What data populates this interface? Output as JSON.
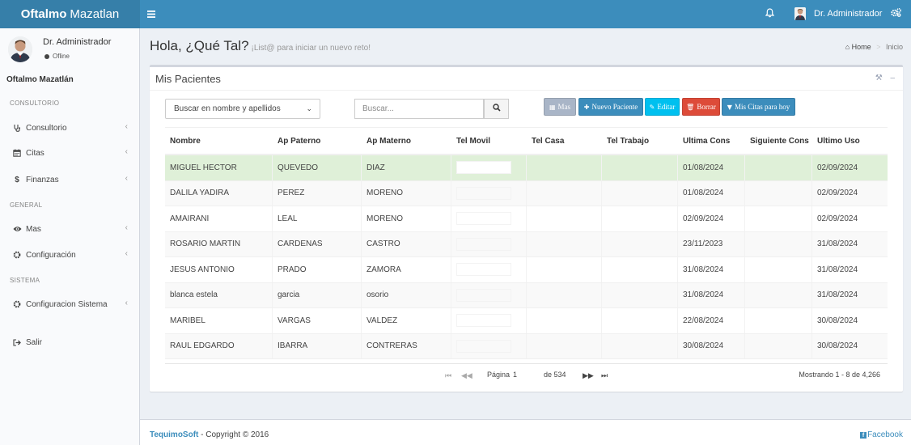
{
  "header": {
    "logo_bold": "Oftalmo",
    "logo_rest": "Mazatlan",
    "user": "Dr. Administrador"
  },
  "sidebar": {
    "user_name": "Dr. Administrador",
    "user_status": "Ofline",
    "brand": "Oftalmo Mazatlán",
    "section_consultorio": "CONSULTORIO",
    "section_general": "GENERAL",
    "section_sistema": "SISTEMA",
    "items": [
      {
        "label": "Consultorio",
        "icon": "stethoscope-icon"
      },
      {
        "label": "Citas",
        "icon": "calendar-icon"
      },
      {
        "label": "Finanzas",
        "icon": "dollar-icon"
      },
      {
        "label": "Mas",
        "icon": "eye-icon"
      },
      {
        "label": "Configuración",
        "icon": "cog-icon"
      },
      {
        "label": "Configuracion Sistema",
        "icon": "cog-icon"
      },
      {
        "label": "Salir",
        "icon": "sign-out-icon"
      }
    ]
  },
  "content": {
    "title": "Hola, ¿Qué Tal?",
    "subtitle": "¡List@ para iniciar un nuevo reto!",
    "breadcrumb_home": "Home",
    "breadcrumb_current": "Inicio"
  },
  "box": {
    "title": "Mis Pacientes",
    "filter_selected": "Buscar en nombre y apellidos",
    "search_placeholder": "Buscar...",
    "buttons": {
      "mas": "Mas",
      "nuevo": "Nuevo Paciente",
      "editar": "Editar",
      "borrar": "Borrar",
      "citas": "Mis Citas para hoy"
    }
  },
  "table": {
    "columns": [
      "Nombre",
      "Ap Paterno",
      "Ap Materno",
      "Tel Movil",
      "Tel Casa",
      "Tel Trabajo",
      "Ultima Cons",
      "Siguiente Cons",
      "Ultimo Uso"
    ],
    "rows": [
      [
        "MIGUEL HECTOR",
        "QUEVEDO",
        "DIAZ",
        "",
        "",
        "",
        "01/08/2024",
        "",
        "02/09/2024"
      ],
      [
        "DALILA YADIRA",
        "PEREZ",
        "MORENO",
        "",
        "",
        "",
        "01/08/2024",
        "",
        "02/09/2024"
      ],
      [
        "AMAIRANI",
        "LEAL",
        "MORENO",
        "",
        "",
        "",
        "02/09/2024",
        "",
        "02/09/2024"
      ],
      [
        "ROSARIO MARTIN",
        "CARDENAS",
        "CASTRO",
        "",
        "",
        "",
        "23/11/2023",
        "",
        "31/08/2024"
      ],
      [
        "JESUS ANTONIO",
        "PRADO",
        "ZAMORA",
        "",
        "",
        "",
        "31/08/2024",
        "",
        "31/08/2024"
      ],
      [
        "blanca estela",
        "garcia",
        "osorio",
        "",
        "",
        "",
        "31/08/2024",
        "",
        "31/08/2024"
      ],
      [
        "MARIBEL",
        "VARGAS",
        "VALDEZ",
        "",
        "",
        "",
        "22/08/2024",
        "",
        "30/08/2024"
      ],
      [
        "RAUL EDGARDO",
        "IBARRA",
        "CONTRERAS",
        "",
        "",
        "",
        "30/08/2024",
        "",
        "30/08/2024"
      ]
    ]
  },
  "pager": {
    "page_label": "Página",
    "page": "1",
    "of": "de 534",
    "info": "Mostrando 1 - 8 de 4,266"
  },
  "footer": {
    "company": "TequimoSoft",
    "copyright": " - Copyright © 2016",
    "facebook": "Facebook"
  },
  "colors": {
    "primary": "#3c8dbc",
    "logo_bg": "#367fa9",
    "danger": "#dd4b39",
    "info": "#00c0ef",
    "selected_row": "#dff0d8"
  }
}
